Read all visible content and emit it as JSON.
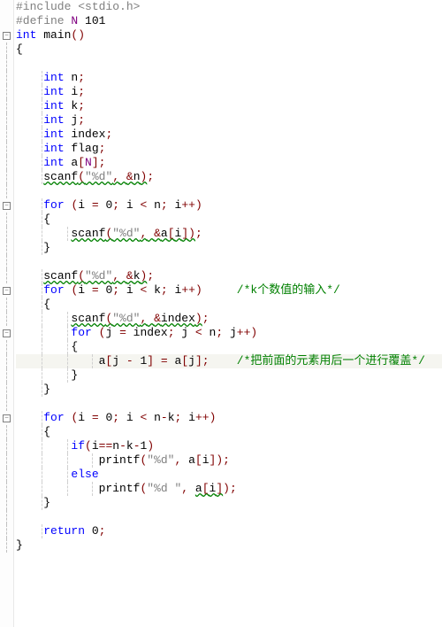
{
  "lines": [
    {
      "text": "#include <stdio.h>",
      "fold": null
    },
    {
      "text": "#define N 101",
      "fold": null
    },
    {
      "text": "int main()",
      "fold": "minus"
    },
    {
      "text": "{",
      "fold": "line"
    },
    {
      "text": "",
      "fold": "line"
    },
    {
      "text": "    int n;",
      "fold": "line"
    },
    {
      "text": "    int i;",
      "fold": "line"
    },
    {
      "text": "    int k;",
      "fold": "line"
    },
    {
      "text": "    int j;",
      "fold": "line"
    },
    {
      "text": "    int index;",
      "fold": "line"
    },
    {
      "text": "    int flag;",
      "fold": "line"
    },
    {
      "text": "    int a[N];",
      "fold": "line"
    },
    {
      "text": "    scanf(\"%d\", &n);",
      "fold": "line",
      "squiggle": true
    },
    {
      "text": "",
      "fold": "line"
    },
    {
      "text": "    for (i = 0; i < n; i++)",
      "fold": "minus"
    },
    {
      "text": "    {",
      "fold": "line"
    },
    {
      "text": "        scanf(\"%d\", &a[i]);",
      "fold": "line",
      "squiggle": true
    },
    {
      "text": "    }",
      "fold": "line"
    },
    {
      "text": "",
      "fold": "line"
    },
    {
      "text": "    scanf(\"%d\", &k);",
      "fold": "line",
      "squiggle": true
    },
    {
      "text": "    for (i = 0; i < k; i++)     /*k个数值的输入*/",
      "fold": "minus"
    },
    {
      "text": "    {",
      "fold": "line"
    },
    {
      "text": "        scanf(\"%d\", &index);",
      "fold": "line",
      "squiggle": true
    },
    {
      "text": "        for (j = index; j < n; j++)",
      "fold": "minus"
    },
    {
      "text": "        {",
      "fold": "line"
    },
    {
      "text": "            a[j - 1] = a[j];    /*把前面的元素用后一个进行覆盖*/",
      "fold": "line",
      "highlight": true
    },
    {
      "text": "        }",
      "fold": "line"
    },
    {
      "text": "    }",
      "fold": "line"
    },
    {
      "text": "",
      "fold": "line"
    },
    {
      "text": "    for (i = 0; i < n-k; i++)",
      "fold": "minus"
    },
    {
      "text": "    {",
      "fold": "line"
    },
    {
      "text": "        if(i==n-k-1)",
      "fold": "line"
    },
    {
      "text": "            printf(\"%d\", a[i]);",
      "fold": "line"
    },
    {
      "text": "        else",
      "fold": "line"
    },
    {
      "text": "            printf(\"%d \", a[i]);",
      "fold": "line",
      "squiggle_partial": "a[i]"
    },
    {
      "text": "    }",
      "fold": "line"
    },
    {
      "text": "",
      "fold": "line"
    },
    {
      "text": "    return 0;",
      "fold": "line"
    },
    {
      "text": "}",
      "fold": "end"
    }
  ],
  "comment1": "/*k个数值的输入*/",
  "comment2": "/*把前面的元素用后一个进行覆盖*/"
}
